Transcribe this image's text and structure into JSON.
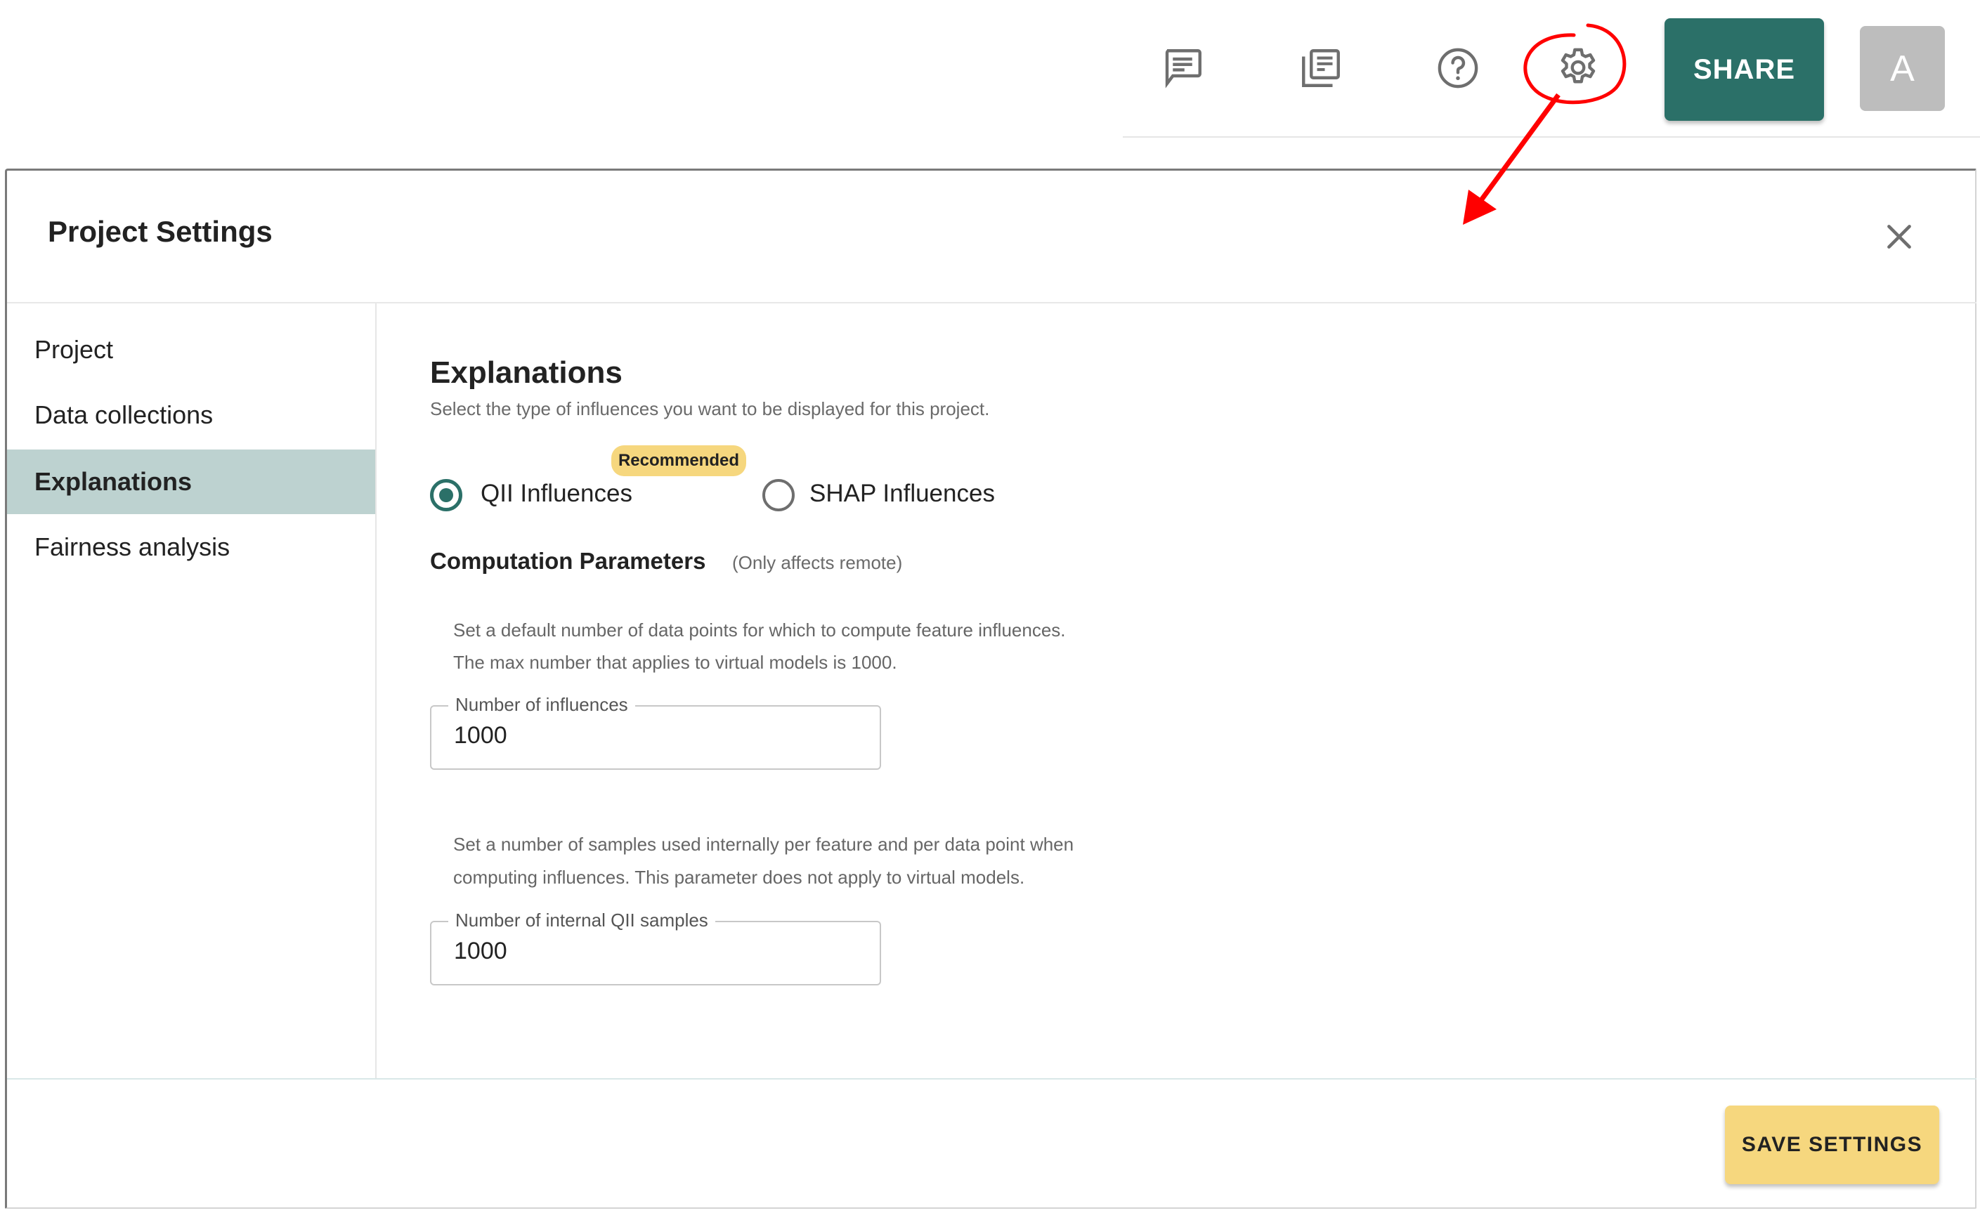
{
  "topbar": {
    "icons": [
      {
        "name": "comments-icon"
      },
      {
        "name": "documentation-icon"
      },
      {
        "name": "help-icon"
      },
      {
        "name": "settings-gear-icon"
      }
    ],
    "share_label": "SHARE",
    "avatar_initial": "A"
  },
  "dialog": {
    "title": "Project Settings",
    "close_icon": "close-icon",
    "sidebar": {
      "items": [
        {
          "label": "Project",
          "active": false
        },
        {
          "label": "Data collections",
          "active": false
        },
        {
          "label": "Explanations",
          "active": true
        },
        {
          "label": "Fairness analysis",
          "active": false
        }
      ]
    },
    "content": {
      "title": "Explanations",
      "subtitle": "Select the type of influences you want to be displayed for this project.",
      "badge": "Recommended",
      "options": [
        {
          "label": "QII Influences",
          "selected": true
        },
        {
          "label": "SHAP Influences",
          "selected": false
        }
      ],
      "params_title": "Computation Parameters",
      "params_note": "(Only affects remote)",
      "influences_help": [
        "Set a default number of data points for which to compute feature influences.",
        "The max number that applies to virtual models is 1000."
      ],
      "influences_field": {
        "label": "Number of influences",
        "value": "1000"
      },
      "samples_help": [
        "Set a number of samples used internally per feature and per data point when",
        "computing influences. This parameter does not apply to virtual models."
      ],
      "samples_field": {
        "label": "Number of internal QII samples",
        "value": "1000"
      }
    },
    "save_label": "SAVE SETTINGS"
  },
  "colors": {
    "primary": "#2b7068",
    "accent_yellow": "#f6d77e",
    "sidebar_active": "#bdd2d0",
    "annotation_red": "#ff0000"
  }
}
